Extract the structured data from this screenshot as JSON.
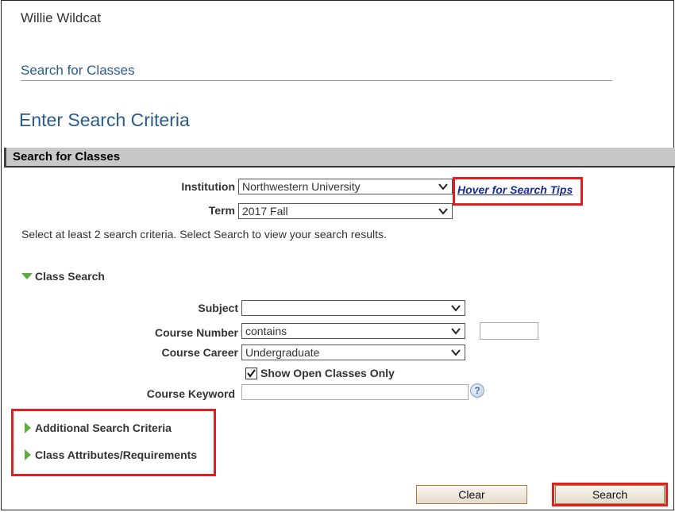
{
  "header": {
    "user_name": "Willie Wildcat",
    "page_link": "Search for Classes",
    "page_title": "Enter Search Criteria"
  },
  "section": {
    "title": "Search for Classes"
  },
  "institution": {
    "label": "Institution",
    "value": "Northwestern University"
  },
  "term": {
    "label": "Term",
    "value": "2017 Fall"
  },
  "search_tips": "Hover for Search Tips",
  "instructions": "Select at least 2 search criteria. Select Search to view your search results.",
  "class_search": {
    "title": "Class Search",
    "subject": {
      "label": "Subject",
      "value": ""
    },
    "course_number": {
      "label": "Course Number",
      "operator": "contains",
      "value": ""
    },
    "course_career": {
      "label": "Course Career",
      "value": "Undergraduate"
    },
    "open_only": {
      "label": "Show Open Classes Only",
      "checked": true
    },
    "course_keyword": {
      "label": "Course Keyword",
      "value": ""
    }
  },
  "collapsibles": {
    "additional": "Additional Search Criteria",
    "attributes": "Class Attributes/Requirements"
  },
  "buttons": {
    "clear": "Clear",
    "search": "Search"
  },
  "colors": {
    "accent": "#2a5b8c",
    "highlight": "#e02020",
    "expander": "#5cae3c"
  }
}
